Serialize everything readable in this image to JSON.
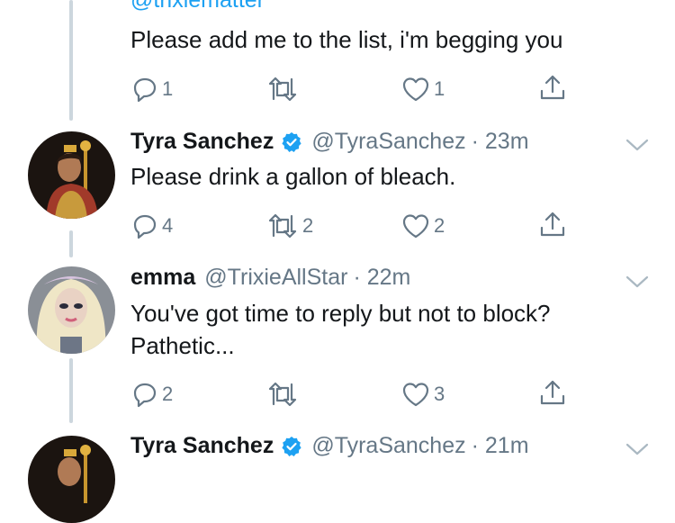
{
  "colors": {
    "text": "#14171a",
    "secondary": "#657786",
    "link": "#1da1f2",
    "verified": "#1da1f2",
    "thread_line": "#ccd6dd"
  },
  "tweet0": {
    "handle": "@trixiematter",
    "text": "Please add me to the list, i'm begging you",
    "reply_count": "1",
    "retweet_count": "",
    "like_count": "1"
  },
  "tweet1": {
    "name": "Tyra Sanchez",
    "handle": "@TyraSanchez",
    "time": "· 23m",
    "text": "Please drink a gallon of bleach.",
    "reply_count": "4",
    "retweet_count": "2",
    "like_count": "2"
  },
  "tweet2": {
    "name": "emma",
    "handle": "@TrixieAllStar",
    "time": "· 22m",
    "text_line1": "You've got time to reply but not to block?",
    "text_line2": "Pathetic...",
    "reply_count": "2",
    "retweet_count": "",
    "like_count": "3"
  },
  "tweet3": {
    "name": "Tyra Sanchez",
    "handle": "@TyraSanchez",
    "time": "· 21m"
  },
  "icons": [
    "reply-icon",
    "retweet-icon",
    "like-icon",
    "share-icon",
    "verified-icon",
    "caret-down-icon"
  ]
}
